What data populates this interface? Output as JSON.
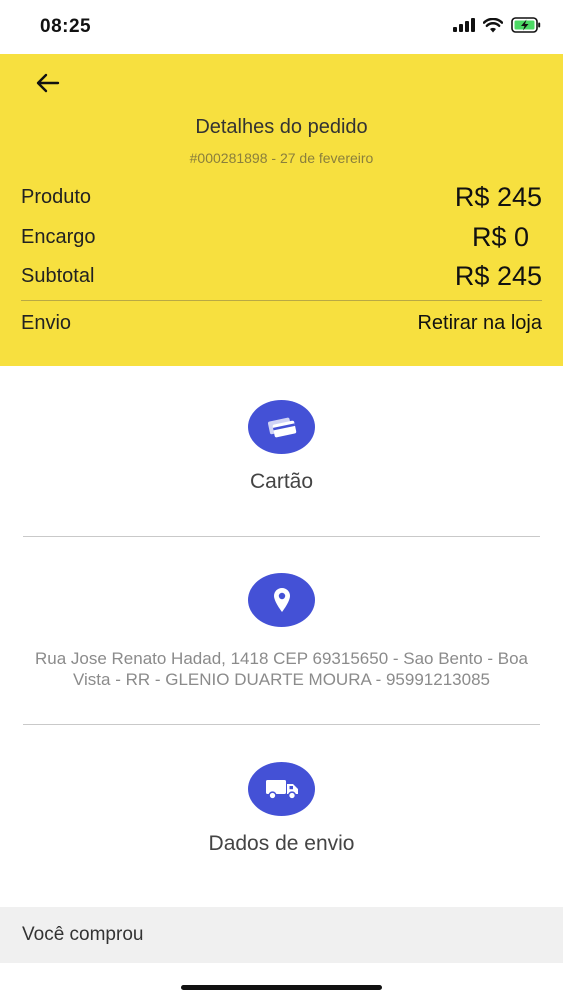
{
  "status_bar": {
    "time": "08:25"
  },
  "header": {
    "title": "Detalhes do pedido",
    "subtitle": "#000281898 - 27 de fevereiro",
    "bg_color": "#f7e03f",
    "rows": [
      {
        "label": "Produto",
        "value": "R$ 245"
      },
      {
        "label": "Encargo",
        "value": "R$ 0"
      },
      {
        "label": "Subtotal",
        "value": "R$ 245"
      },
      {
        "label": "Envio",
        "value": "Retirar na loja"
      }
    ]
  },
  "payment": {
    "icon": "credit-card-icon",
    "label": "Cartão"
  },
  "address": {
    "icon": "location-pin-icon",
    "text": "Rua Jose Renato Hadad, 1418 CEP 69315650 - Sao Bento - Boa Vista - RR - GLENIO DUARTE MOURA - 95991213085"
  },
  "shipping": {
    "icon": "truck-icon",
    "label": "Dados de envio"
  },
  "purchased": {
    "label": "Você comprou"
  },
  "accent_color": "#4451d6"
}
